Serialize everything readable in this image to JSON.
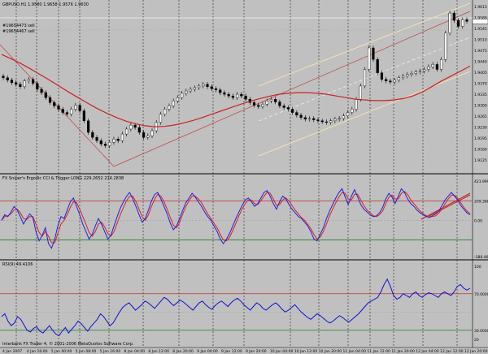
{
  "window": {
    "symbol_label": "GBPUSD,H1  1.9580 1.9658 1.9576 1.9630",
    "order_1": "#19654473 sell",
    "order_2": "#19654467 sell",
    "ind1_label": "FX Sniper's Ergodic CCI & Trigger LONG 229.2652 214.2838",
    "ind2_label": "RSI(9) 49.4106",
    "copyright": "Interbank FX Trader 4, © 2001-2006 MetaQuotes Software Corp."
  },
  "price_axis": [
    "1.9615",
    "1.9580",
    "1.9545",
    "1.9510",
    "1.9475",
    "1.9440",
    "1.9405",
    "1.9370",
    "1.9335",
    "1.9300",
    "1.9265",
    "1.9230",
    "1.9195",
    "1.9160",
    "1.9125"
  ],
  "cci_axis": [
    "421.9994",
    "209.3889",
    "0.00",
    "-388.4625"
  ],
  "rsi_axis": [
    "100",
    "70.0000",
    "30.0000",
    "20"
  ],
  "time_axis": [
    "4 Jan 2007",
    "4 Jan 16:00",
    "5 Jan 00:00",
    "5 Jan 08:00",
    "5 Jan 16:00",
    "8 Jan 04:00",
    "8 Jan 12:00",
    "8 Jan 20:00",
    "9 Jan 04:00",
    "9 Jan 12:00",
    "9 Jan 20:00",
    "10 Jan 04:00",
    "10 Jan 12:00",
    "10 Jan 20:00",
    "11 Jan 04:00",
    "11 Jan 12:00",
    "11 Jan 20:00",
    "12 Jan 04:00",
    "12 Jan 12:00",
    "12 Jan 20:00"
  ],
  "chart_data": [
    {
      "type": "candlestick",
      "title": "GBPUSD,H1",
      "ylim": [
        1.9125,
        1.9615
      ],
      "close": [
        1.9405,
        1.9398,
        1.939,
        1.9385,
        1.9378,
        1.9395,
        1.94,
        1.9388,
        1.937,
        1.936,
        1.9345,
        1.933,
        1.932,
        1.931,
        1.93,
        1.9295,
        1.931,
        1.9322,
        1.9305,
        1.9275,
        1.924,
        1.9225,
        1.9215,
        1.9205,
        1.92,
        1.921,
        1.922,
        1.9215,
        1.9235,
        1.925,
        1.9262,
        1.9255,
        1.924,
        1.9225,
        1.923,
        1.9245,
        1.927,
        1.9295,
        1.931,
        1.932,
        1.9335,
        1.9345,
        1.9358,
        1.9365,
        1.937,
        1.9375,
        1.938,
        1.9385,
        1.9378,
        1.9372,
        1.9368,
        1.936,
        1.9355,
        1.935,
        1.9345,
        1.9355,
        1.935,
        1.934,
        1.933,
        1.9322,
        1.9318,
        1.9325,
        1.9335,
        1.934,
        1.9332,
        1.932,
        1.9315,
        1.931,
        1.93,
        1.9292,
        1.9285,
        1.928,
        1.9282,
        1.9278,
        1.9275,
        1.9272,
        1.927,
        1.9275,
        1.928,
        1.9282,
        1.929,
        1.93,
        1.931,
        1.934,
        1.938,
        1.943,
        1.9495,
        1.946,
        1.942,
        1.94,
        1.9395,
        1.9392,
        1.9398,
        1.9405,
        1.941,
        1.9415,
        1.9418,
        1.9422,
        1.9425,
        1.943,
        1.9438,
        1.9445,
        1.943,
        1.946,
        1.954,
        1.96,
        1.9578,
        1.956,
        1.958,
        1.9575
      ],
      "series": [
        {
          "name": "MA",
          "color": "#cc2222",
          "values": [
            1.9475,
            1.9462,
            1.9448,
            1.9432,
            1.9415,
            1.9398,
            1.938,
            1.9362,
            1.9345,
            1.9328,
            1.9312,
            1.9298,
            1.9285,
            1.9274,
            1.9266,
            1.926,
            1.9257,
            1.9258,
            1.9262,
            1.9268,
            1.9276,
            1.9285,
            1.9295,
            1.9305,
            1.9315,
            1.9325,
            1.9334,
            1.9342,
            1.9349,
            1.9355,
            1.9358,
            1.936,
            1.936,
            1.9358,
            1.9355,
            1.935,
            1.9345,
            1.934,
            1.9338,
            1.9336,
            1.9336,
            1.9338,
            1.9342,
            1.935,
            1.9362,
            1.9378,
            1.9395,
            1.941,
            1.9425,
            1.944
          ]
        }
      ]
    },
    {
      "type": "line",
      "title": "FX Sniper's Ergodic CCI & Trigger",
      "ylim": [
        -388.4625,
        421.9994
      ],
      "series": [
        {
          "name": "CCI",
          "color": "#2020e0",
          "values": [
            0,
            60,
            40,
            90,
            150,
            110,
            40,
            -40,
            20,
            70,
            30,
            -120,
            -220,
            -160,
            -80,
            -250,
            -300,
            -200,
            -60,
            40,
            20,
            110,
            200,
            240,
            150,
            60,
            -40,
            -120,
            -200,
            -150,
            -60,
            20,
            -40,
            -120,
            -200,
            -160,
            -60,
            40,
            130,
            200,
            260,
            300,
            230,
            150,
            60,
            -20,
            20,
            110,
            210,
            280,
            300,
            230,
            150,
            70,
            -30,
            -100,
            -60,
            20,
            110,
            190,
            240,
            290,
            250,
            200,
            150,
            90,
            40,
            0,
            -60,
            -120,
            -200,
            -250,
            -200,
            -140,
            -60,
            20,
            90,
            160,
            220,
            240,
            200,
            150,
            180,
            240,
            300,
            320,
            260,
            180,
            120,
            200,
            260,
            230,
            170,
            120,
            80,
            40,
            20,
            -20,
            -60,
            -120,
            -200,
            -220,
            -150,
            -80,
            20,
            100,
            170,
            240,
            300,
            340,
            250,
            170,
            260,
            330,
            250,
            170,
            120,
            90,
            60,
            40,
            50,
            80,
            140,
            230,
            290,
            250,
            180,
            260,
            340,
            300,
            230,
            180,
            150,
            110,
            80,
            60,
            40,
            30,
            50,
            70,
            100,
            160,
            220,
            260,
            300,
            260,
            220,
            160,
            120,
            80,
            60
          ]
        },
        {
          "name": "Trigger",
          "color": "#dd2020",
          "values": [
            0,
            40,
            50,
            70,
            110,
            120,
            80,
            20,
            10,
            40,
            40,
            -40,
            -130,
            -170,
            -120,
            -170,
            -240,
            -240,
            -140,
            -40,
            0,
            60,
            140,
            200,
            190,
            120,
            40,
            -40,
            -130,
            -170,
            -120,
            -40,
            -20,
            -70,
            -140,
            -170,
            -120,
            -30,
            60,
            140,
            210,
            260,
            260,
            200,
            120,
            40,
            0,
            60,
            150,
            230,
            280,
            260,
            200,
            120,
            30,
            -50,
            -80,
            -20,
            70,
            150,
            210,
            260,
            260,
            230,
            190,
            130,
            70,
            20,
            -30,
            -80,
            -150,
            -210,
            -220,
            -180,
            -110,
            -30,
            50,
            120,
            180,
            220,
            220,
            180,
            170,
            210,
            260,
            300,
            290,
            230,
            160,
            170,
            220,
            240,
            210,
            160,
            110,
            70,
            30,
            0,
            -40,
            -90,
            -150,
            -200,
            -180,
            -120,
            -40,
            50,
            120,
            190,
            250,
            300,
            290,
            230,
            220,
            280,
            280,
            220,
            160,
            110,
            80,
            50,
            40,
            60,
            100,
            180,
            250,
            270,
            230,
            230,
            290,
            310,
            280,
            220,
            180,
            140,
            100,
            70,
            50,
            40,
            40,
            50,
            80,
            120,
            180,
            230,
            270,
            270,
            240,
            190,
            140,
            100,
            70
          ]
        }
      ]
    },
    {
      "type": "line",
      "title": "RSI(9)",
      "ylim": [
        20,
        100
      ],
      "series": [
        {
          "name": "RSI(9)",
          "color": "#1010d0",
          "values": [
            45,
            48,
            40,
            35,
            38,
            45,
            42,
            36,
            30,
            28,
            32,
            34,
            29,
            27,
            31,
            35,
            30,
            26,
            24,
            29,
            33,
            27,
            31,
            35,
            40,
            37,
            33,
            29,
            34,
            38,
            42,
            48,
            45,
            40,
            35,
            38,
            44,
            50,
            55,
            58,
            60,
            56,
            52,
            55,
            58,
            62,
            60,
            57,
            54,
            58,
            62,
            66,
            64,
            60,
            57,
            60,
            63,
            61,
            58,
            55,
            52,
            56,
            60,
            62,
            58,
            55,
            53,
            57,
            60,
            62,
            59,
            56,
            60,
            63,
            65,
            62,
            58,
            55,
            52,
            56,
            60,
            58,
            54,
            52,
            55,
            58,
            60,
            57,
            53,
            50,
            52,
            55,
            58,
            54,
            50,
            47,
            44,
            42,
            45,
            48,
            46,
            43,
            40,
            38,
            40,
            43,
            46,
            44,
            41,
            39,
            42,
            45,
            48,
            52,
            56,
            60,
            62,
            64,
            66,
            72,
            80,
            86,
            78,
            68,
            64,
            66,
            70,
            68,
            66,
            70,
            72,
            68,
            66,
            69,
            71,
            70,
            68,
            66,
            70,
            72,
            70,
            68,
            72,
            78,
            80,
            76,
            74,
            76
          ]
        }
      ]
    }
  ]
}
